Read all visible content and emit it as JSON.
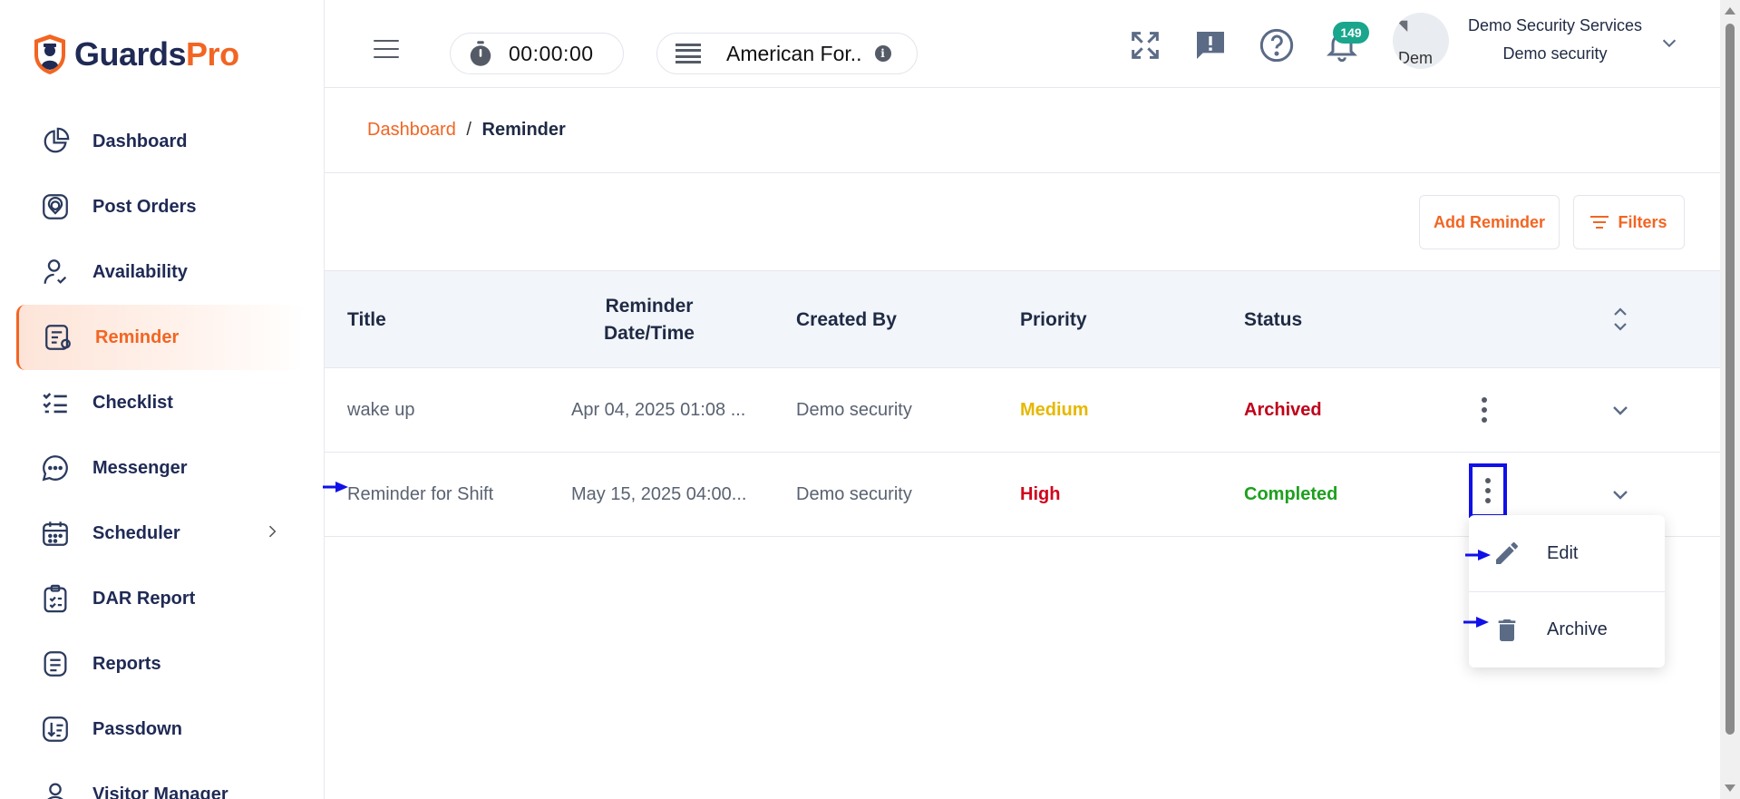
{
  "brand": {
    "name_part1": "Guards",
    "name_part2": "Pro",
    "primary": "#1f2a55",
    "accent": "#f26522"
  },
  "sidebar": {
    "items": [
      {
        "label": "Dashboard",
        "icon": "chart-pie-icon"
      },
      {
        "label": "Post Orders",
        "icon": "location-pin-icon"
      },
      {
        "label": "Availability",
        "icon": "user-check-icon"
      },
      {
        "label": "Reminder",
        "icon": "reminder-icon",
        "active": true
      },
      {
        "label": "Checklist",
        "icon": "checklist-icon"
      },
      {
        "label": "Messenger",
        "icon": "chat-bubble-icon"
      },
      {
        "label": "Scheduler",
        "icon": "calendar-icon",
        "has_children": true
      },
      {
        "label": "DAR Report",
        "icon": "clipboard-icon"
      },
      {
        "label": "Reports",
        "icon": "document-icon"
      },
      {
        "label": "Passdown",
        "icon": "sort-down-icon"
      },
      {
        "label": "Visitor Manager",
        "icon": "visitor-icon"
      }
    ]
  },
  "header": {
    "timer": "00:00:00",
    "site": "American For..",
    "notifications_count": "149",
    "avatar_alt": "Dem",
    "company": "Demo Security Services",
    "user_name": "Demo security"
  },
  "breadcrumb": {
    "root": "Dashboard",
    "separator": "/",
    "current": "Reminder"
  },
  "actions": {
    "add_label": "Add Reminder",
    "filter_label": "Filters"
  },
  "table": {
    "columns": {
      "title": "Title",
      "datetime_line1": "Reminder",
      "datetime_line2": "Date/Time",
      "created_by": "Created By",
      "priority": "Priority",
      "status": "Status"
    },
    "rows": [
      {
        "title": "wake up",
        "datetime": "Apr 04, 2025 01:08 ...",
        "created_by": "Demo security",
        "priority": "Medium",
        "status": "Archived"
      },
      {
        "title": "Reminder for Shift",
        "datetime": "May 15, 2025 04:00...",
        "created_by": "Demo security",
        "priority": "High",
        "status": "Completed"
      }
    ]
  },
  "row_menu": {
    "edit_label": "Edit",
    "archive_label": "Archive"
  },
  "colors": {
    "priority_medium": "#e6b800",
    "priority_high": "#d0021b",
    "status_archived": "#c0001a",
    "status_completed": "#1ea01e",
    "highlight": "#1010e8"
  }
}
